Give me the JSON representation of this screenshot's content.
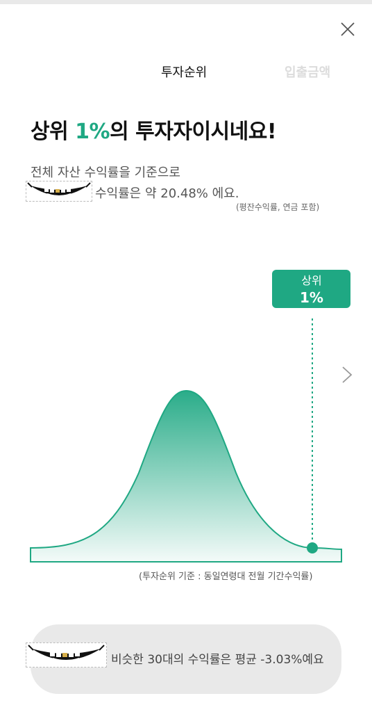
{
  "tabs": [
    {
      "label": "투자순위",
      "active": true
    },
    {
      "label": "입출금액",
      "active": false
    }
  ],
  "headline": {
    "prefix": "상위 ",
    "accent": "1%",
    "suffix": "의 투자자이시네요!"
  },
  "description": {
    "line1": "전체 자산 수익률을 기준으로",
    "line2": "수익률은 약 20.48% 에요.",
    "note": "(평잔수익률, 연금 포함)"
  },
  "chart_data": {
    "type": "area",
    "marker": {
      "label_line1": "상위",
      "label_line2": "1%",
      "percentile_top": 1
    },
    "caption": "(투자순위 기준 : 동일연령대 전월 기간수익률)"
  },
  "comparison": {
    "text": "비슷한 30대의 수익률은 평균 -3.03%예요"
  },
  "icons": {
    "close": "close-icon",
    "next": "chevron-right-icon",
    "avatar": "grin-mask-icon"
  },
  "colors": {
    "accent": "#1fa883",
    "pill_bg": "#e9e9e9",
    "inactive_tab": "#dcdcdc"
  }
}
